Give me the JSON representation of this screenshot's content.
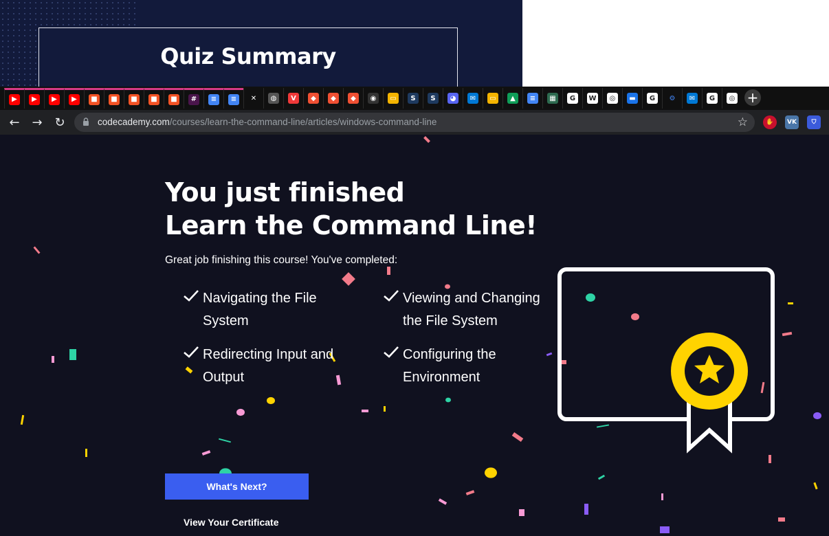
{
  "background_page": {
    "quiz_title": "Quiz Summary"
  },
  "tabs": {
    "icons": [
      "youtube-icon",
      "youtube-icon",
      "youtube-icon",
      "youtube-icon",
      "microsoft-icon",
      "microsoft-icon",
      "microsoft-icon",
      "microsoft-icon",
      "microsoft-icon",
      "slack-icon",
      "google-docs-icon",
      "google-docs-icon",
      "close-icon",
      "globe-icon",
      "vivaldi-icon",
      "git-icon",
      "git-icon",
      "git-icon",
      "github-icon",
      "google-slides-icon",
      "s-icon",
      "s-icon",
      "discord-icon",
      "mail-icon",
      "google-slides-icon",
      "google-drive-icon",
      "google-docs-icon",
      "sheet-icon",
      "google-icon",
      "wikipedia-icon",
      "chrome-icon",
      "chat-icon",
      "google-icon",
      "gear-icon",
      "mail-icon",
      "google-icon",
      "chrome-icon"
    ],
    "new_tab_label": "+"
  },
  "toolbar": {
    "back_label": "←",
    "forward_label": "→",
    "reload_label": "↻",
    "url_host": "codecademy.com",
    "url_path": "/courses/learn-the-command-line/articles/windows-command-line",
    "star_label": "☆",
    "extensions": [
      "adblock-icon",
      "vk-icon",
      "shield-icon"
    ]
  },
  "main": {
    "heading_line1": "You just finished",
    "heading_line2": "Learn the Command Line!",
    "subtitle": "Great job finishing this course! You've completed:",
    "items": [
      {
        "line1": "Navigating the File",
        "line2": "System"
      },
      {
        "line1": "Viewing and Changing",
        "line2": "the File System"
      },
      {
        "line1": "Redirecting Input and",
        "line2": "Output"
      },
      {
        "line1": "Configuring the",
        "line2": "Environment"
      }
    ],
    "whats_next_label": "What's Next?",
    "view_certificate_label": "View Your Certificate"
  },
  "colors": {
    "accent_blue": "#3a5ef0",
    "badge_yellow": "#ffd300",
    "page_bg": "#10111f",
    "tab_accent": "#d63a86"
  }
}
